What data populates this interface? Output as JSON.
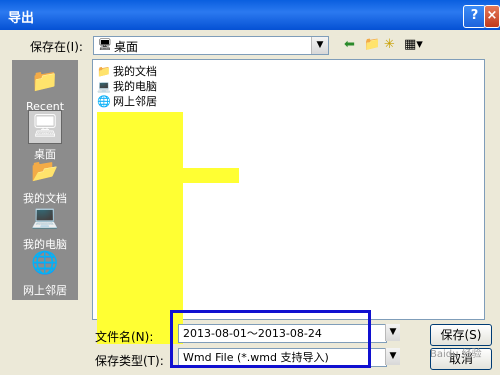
{
  "window": {
    "title": "导出",
    "help": "?",
    "close": "×"
  },
  "save_in": {
    "label": "保存在(I):",
    "value": "桌面"
  },
  "places": [
    {
      "label": "Recent",
      "icon": "recent-folder-icon",
      "glyph": "📁"
    },
    {
      "label": "桌面",
      "icon": "desktop-icon",
      "glyph": "🖥"
    },
    {
      "label": "我的文档",
      "icon": "my-documents-icon",
      "glyph": "📂"
    },
    {
      "label": "我的电脑",
      "icon": "my-computer-icon",
      "glyph": "💻"
    },
    {
      "label": "网上邻居",
      "icon": "network-places-icon",
      "glyph": "🌐"
    }
  ],
  "files": [
    {
      "name": "我的文档",
      "icon": "folder-icon",
      "glyph": "📁"
    },
    {
      "name": "我的电脑",
      "icon": "computer-icon",
      "glyph": "💻"
    },
    {
      "name": "网上邻居",
      "icon": "network-icon",
      "glyph": "🌐"
    }
  ],
  "filename": {
    "label": "文件名(N):",
    "value": "2013-08-01～2013-08-24"
  },
  "filetype": {
    "label": "保存类型(T):",
    "value": "Wmd File (*.wmd 支持导入)"
  },
  "buttons": {
    "save": "保存(S)",
    "cancel": "取消"
  },
  "watermark": "Baidu 经验",
  "colors": {
    "titlebar": "#0a5fdf",
    "redaction": "#ffff33",
    "highlight": "#1010d0"
  }
}
